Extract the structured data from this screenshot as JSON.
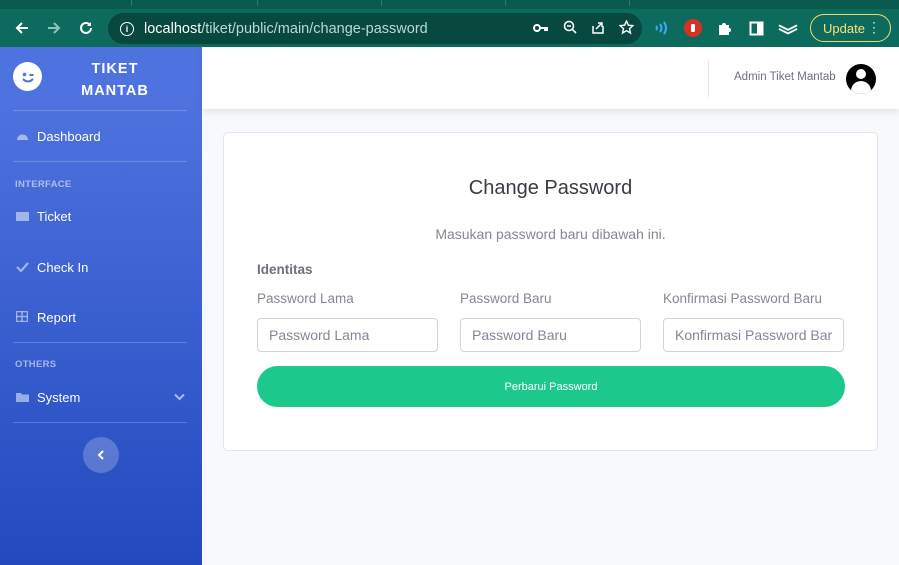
{
  "browser": {
    "url_host": "localhost",
    "url_path": "/tiket/public/main/change-password",
    "update_label": "Update",
    "colors": {
      "frame": "#0d6b5e",
      "omnibox": "#07483f",
      "update_border": "#f2d96b"
    },
    "icons": [
      "back-arrow-icon",
      "forward-arrow-icon",
      "reload-icon",
      "site-info-icon",
      "key-icon",
      "zoom-icon",
      "share-icon",
      "bookmark-star-icon",
      "extension-wave-icon",
      "extension-stop-icon",
      "puzzle-icon",
      "side-panel-icon",
      "layers-icon",
      "more-vertical-icon"
    ]
  },
  "sidebar": {
    "brand_line1": "TIKET",
    "brand_line2": "MANTAB",
    "items": [
      {
        "label": "Dashboard",
        "icon": "dashboard-icon"
      },
      {
        "label": "Ticket",
        "icon": "ticket-icon"
      },
      {
        "label": "Check In",
        "icon": "check-icon"
      },
      {
        "label": "Report",
        "icon": "table-icon"
      },
      {
        "label": "System",
        "icon": "folder-icon"
      }
    ],
    "sections": [
      "INTERFACE",
      "OTHERS"
    ],
    "colors": {
      "gradient_top": "#4e73df",
      "gradient_bottom": "#224abe"
    }
  },
  "topbar": {
    "user_name": "Admin Tiket Mantab"
  },
  "form": {
    "title": "Change Password",
    "subtitle": "Masukan password baru dibawah ini.",
    "group_label": "Identitas",
    "fields": [
      {
        "label": "Password Lama",
        "placeholder": "Password Lama"
      },
      {
        "label": "Password Baru",
        "placeholder": "Password Baru"
      },
      {
        "label": "Konfirmasi Password Baru",
        "placeholder": "Konfirmasi Password Baru"
      }
    ],
    "submit_label": "Perbarui Password",
    "colors": {
      "submit": "#1cc88a"
    }
  }
}
